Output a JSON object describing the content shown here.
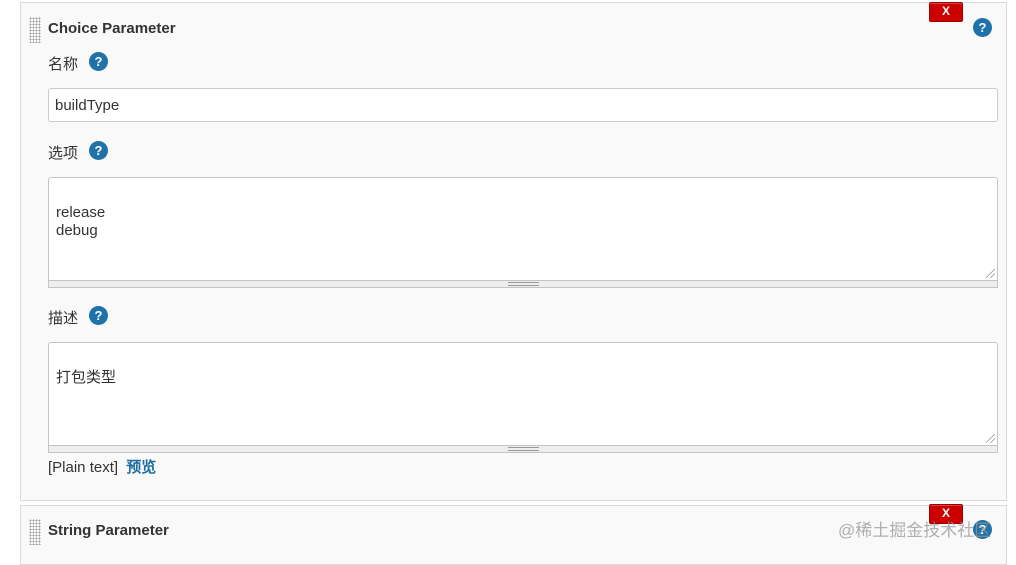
{
  "choice_parameter": {
    "title": "Choice Parameter",
    "delete_label": "X",
    "help_label": "?",
    "name_field": {
      "label": "名称",
      "value": "buildType"
    },
    "choices_field": {
      "label": "选项",
      "value": "release\ndebug"
    },
    "description_field": {
      "label": "描述",
      "value": "打包类型"
    },
    "format_label": "[Plain text]",
    "preview_link": "预览"
  },
  "string_parameter": {
    "title": "String Parameter",
    "delete_label": "X",
    "help_label": "?"
  },
  "watermark": "@稀土掘金技术社区",
  "colors": {
    "delete_button": "#cc0000",
    "help_icon": "#1f72a9",
    "link": "#1f6ea0",
    "panel_bg": "#f9f9f9"
  }
}
